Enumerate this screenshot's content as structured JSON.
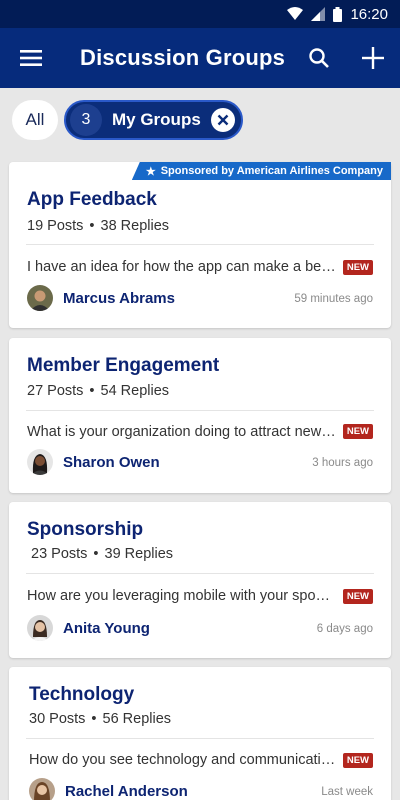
{
  "status_bar": {
    "time": "16:20"
  },
  "app_bar": {
    "title": "Discussion Groups"
  },
  "filters": {
    "all_label": "All",
    "my_groups_count": "3",
    "my_groups_label": "My Groups"
  },
  "groups": [
    {
      "name": "App Feedback",
      "posts": "19 Posts",
      "replies": "38 Replies",
      "sponsor": "Sponsored by American Airlines Company",
      "preview": "I have an idea for how the app can make a better experience",
      "badge": "NEW",
      "author": "Marcus Abrams",
      "time": "59 minutes ago"
    },
    {
      "name": "Member Engagement",
      "posts": "27 Posts",
      "replies": "54 Replies",
      "preview": "What is your organization doing to attract new members",
      "badge": "NEW",
      "author": "Sharon Owen",
      "time": "3 hours ago"
    },
    {
      "name": "Sponsorship",
      "posts": "23 Posts",
      "replies": "39 Replies",
      "preview": "How are you leveraging mobile with your sponsors",
      "badge": "NEW",
      "author": "Anita Young",
      "time": "6 days ago"
    },
    {
      "name": "Technology",
      "posts": "30 Posts",
      "replies": "56 Replies",
      "preview": "How do you see technology and communication evolving",
      "badge": "NEW",
      "author": "Rachel Anderson",
      "time": "Last week"
    }
  ],
  "dot": "•",
  "star": "★"
}
